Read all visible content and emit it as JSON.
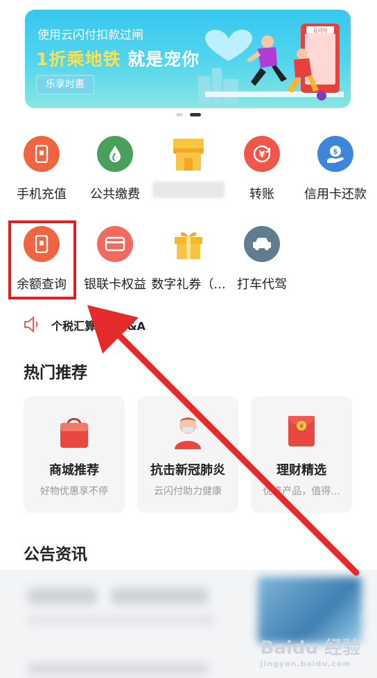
{
  "banner": {
    "subtitle": "使用云闪付扣款过闸",
    "title_highlight": "1折乘地铁",
    "title_rest": "就是宠你",
    "button": "乐享时惠",
    "pill_text": "云闪付",
    "page_count": 2,
    "active_index": 1
  },
  "services": [
    {
      "label": "手机充值",
      "icon": "phone-recharge-icon",
      "color": "#f0643f"
    },
    {
      "label": "公共缴费",
      "icon": "water-drop-icon",
      "color": "#4aa05a"
    },
    {
      "label": "",
      "icon": "store-icon",
      "color": "#f6b62d"
    },
    {
      "label": "转账",
      "icon": "transfer-icon",
      "color": "#f2554a"
    },
    {
      "label": "信用卡还款",
      "icon": "credit-card-repay-icon",
      "color": "#3d86d9"
    },
    {
      "label": "余额查询",
      "icon": "balance-query-icon",
      "color": "#f0643f"
    },
    {
      "label": "银联卡权益",
      "icon": "card-benefit-icon",
      "color": "#f26a5e"
    },
    {
      "label": "数字礼券（...",
      "icon": "gift-coupon-icon",
      "color": "#f6b62d"
    },
    {
      "label": "打车代驾",
      "icon": "car-icon",
      "color": "#5f7d8f"
    }
  ],
  "notice": {
    "text": "个税汇算清缴Q&A"
  },
  "hot": {
    "title": "热门推荐",
    "cards": [
      {
        "title": "商城推荐",
        "subtitle": "好物优惠享不停",
        "icon": "shopping-bag-icon"
      },
      {
        "title": "抗击新冠肺炎",
        "subtitle": "云闪付助力健康",
        "icon": "doctor-icon"
      },
      {
        "title": "理财精选",
        "subtitle": "优选产品，值得...",
        "icon": "red-envelope-icon"
      }
    ]
  },
  "news": {
    "title": "公告资讯"
  },
  "watermark": {
    "main": "Baidu 经验",
    "sub": "jingyan.baidu.com"
  }
}
